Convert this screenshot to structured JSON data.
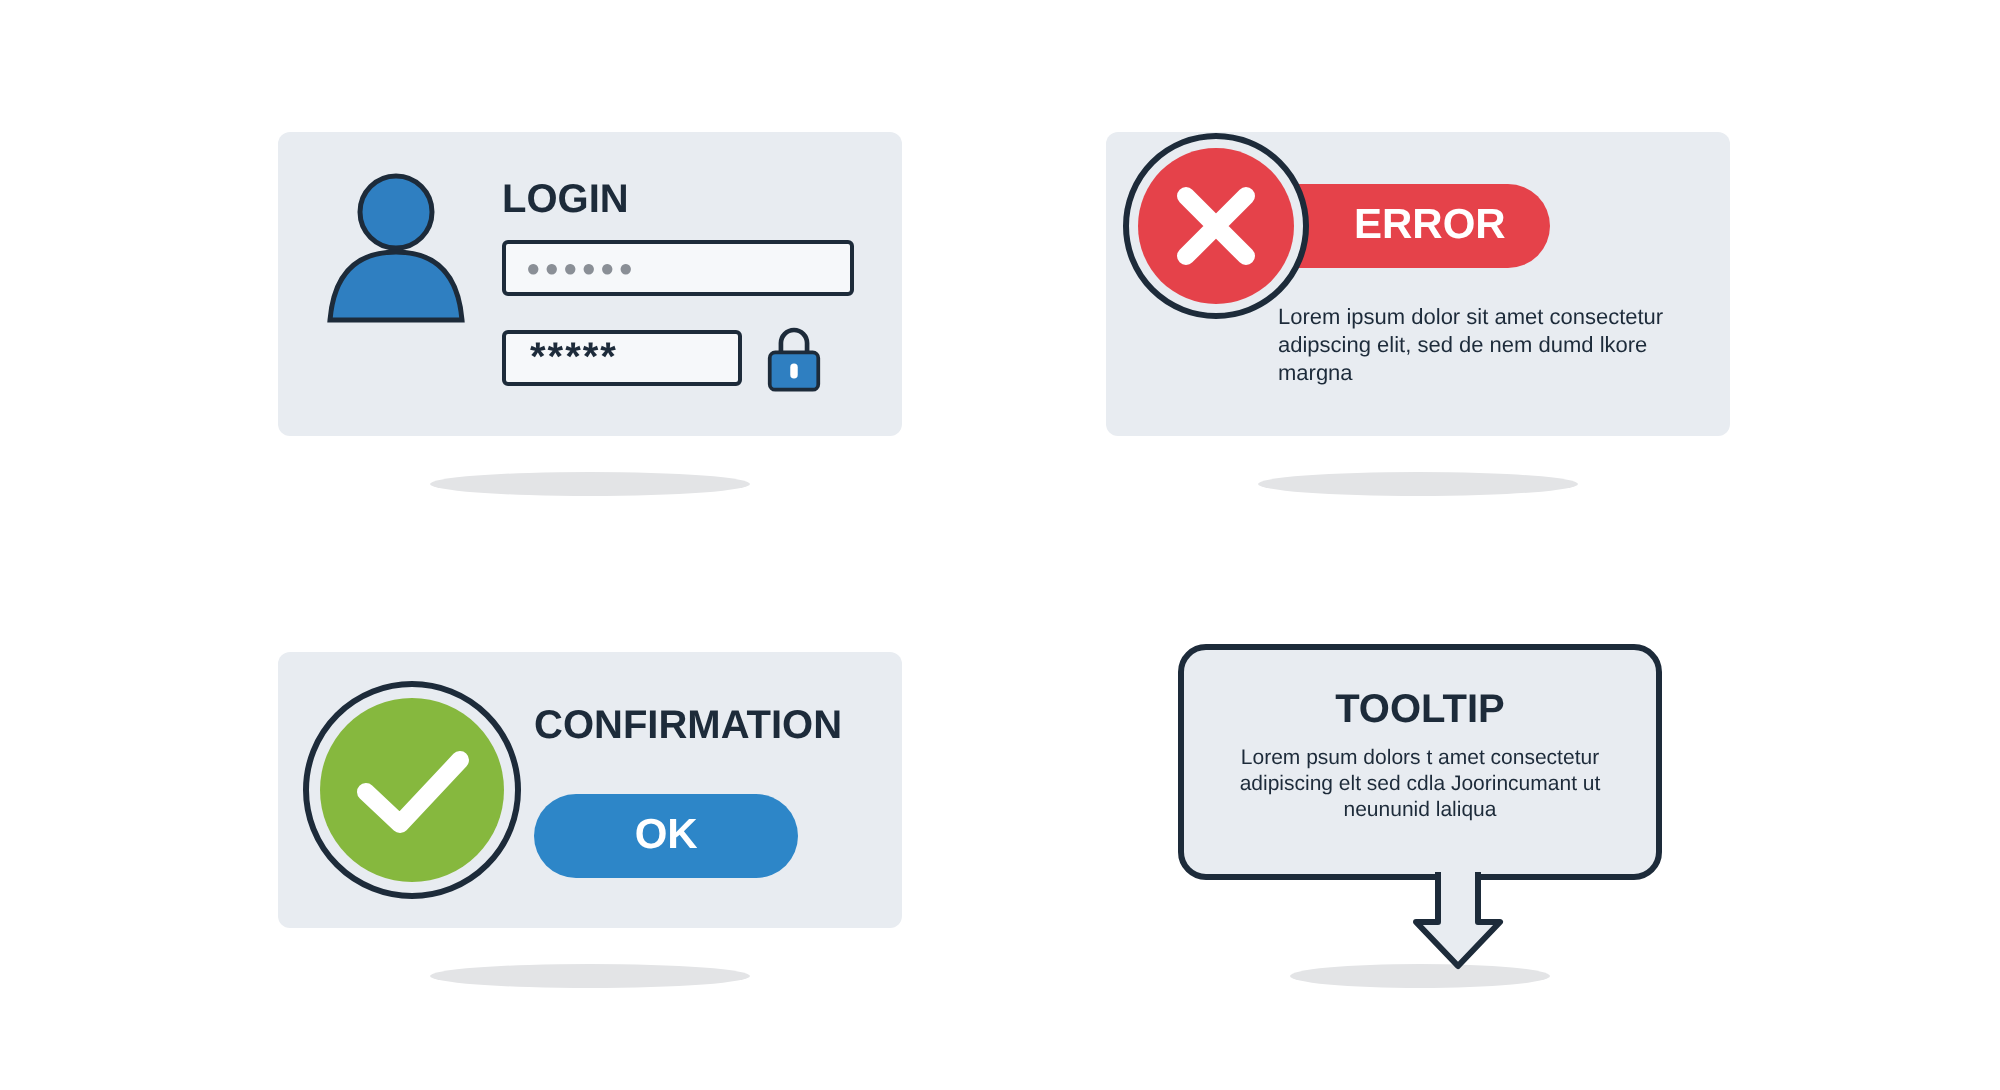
{
  "login": {
    "title": "LOGIN",
    "username": {
      "placeholder": "●●●●●●"
    },
    "password": {
      "value": "*****"
    }
  },
  "error": {
    "badge": "ERROR",
    "message": "Lorem ipsum dolor sit amet  consectetur adipscing elit, sed de nem dumd lkore margna"
  },
  "confirmation": {
    "title": "CONFIRMATION",
    "buttons": [
      "OK"
    ]
  },
  "tooltip": {
    "title": "TOOLTIP",
    "text": "Lorem psum dolors t amet  consectetur adipiscing elt  sed cdla Joorincumant ut neununid laliqua"
  }
}
